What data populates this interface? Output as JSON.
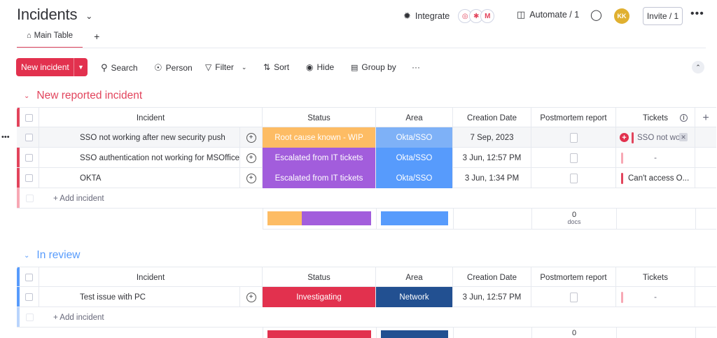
{
  "header": {
    "title": "Incidents",
    "integrate_label": "Integrate",
    "automate_label": "Automate / 1",
    "avatar_initials": "KK",
    "invite_label": "Invite / 1"
  },
  "tabs": {
    "main_table_label": "Main Table",
    "add_tab": "+"
  },
  "toolbar": {
    "new_label": "New incident",
    "search_label": "Search",
    "person_label": "Person",
    "filter_label": "Filter",
    "sort_label": "Sort",
    "hide_label": "Hide",
    "group_by_label": "Group by",
    "more": "···"
  },
  "columns": {
    "incident": "Incident",
    "status": "Status",
    "area": "Area",
    "creation_date": "Creation Date",
    "postmortem": "Postmortem report",
    "tickets": "Tickets",
    "add": "+"
  },
  "groups": [
    {
      "title": "New reported incident",
      "color": "#e2445c",
      "rows": [
        {
          "name": "SSO not working after new security push",
          "status": "Root cause known - WIP",
          "status_color": "#fdbc64",
          "area": "Okta/SSO",
          "area_color": "#579bfc",
          "date": "7 Sep, 2023",
          "ticket": "SSO not wo",
          "dash": ""
        },
        {
          "name": "SSO authentication not working for MSOffice",
          "status": "Escalated from IT tickets",
          "status_color": "#a25ddc",
          "area": "Okta/SSO",
          "area_color": "#579bfc",
          "date": "3 Jun, 12:57 PM",
          "ticket": "",
          "dash": "-"
        },
        {
          "name": "OKTA",
          "status": "Escalated from IT tickets",
          "status_color": "#a25ddc",
          "area": "Okta/SSO",
          "area_color": "#579bfc",
          "date": "3 Jun, 1:34 PM",
          "ticket": "Can't access O...",
          "dash": ""
        }
      ],
      "add_label": "+ Add incident",
      "summary": {
        "count": "0",
        "unit": "docs"
      }
    },
    {
      "title": "In review",
      "color": "#579bfc",
      "rows": [
        {
          "name": "Test issue with PC",
          "status": "Investigating",
          "status_color": "#e2314e",
          "area": "Network",
          "area_color": "#225091",
          "date": "3 Jun, 12:57 PM",
          "ticket": "",
          "dash": "-"
        }
      ],
      "add_label": "+ Add incident",
      "summary": {
        "count": "0",
        "unit": ""
      }
    }
  ],
  "colors": {
    "accent": "#e2314e",
    "group1": "#e2445c",
    "group2": "#579bfc",
    "status_wip": "#fdbc64",
    "status_escalated": "#a25ddc",
    "status_investigating": "#e2314e",
    "area_okta": "#579bfc",
    "area_network": "#225091"
  }
}
